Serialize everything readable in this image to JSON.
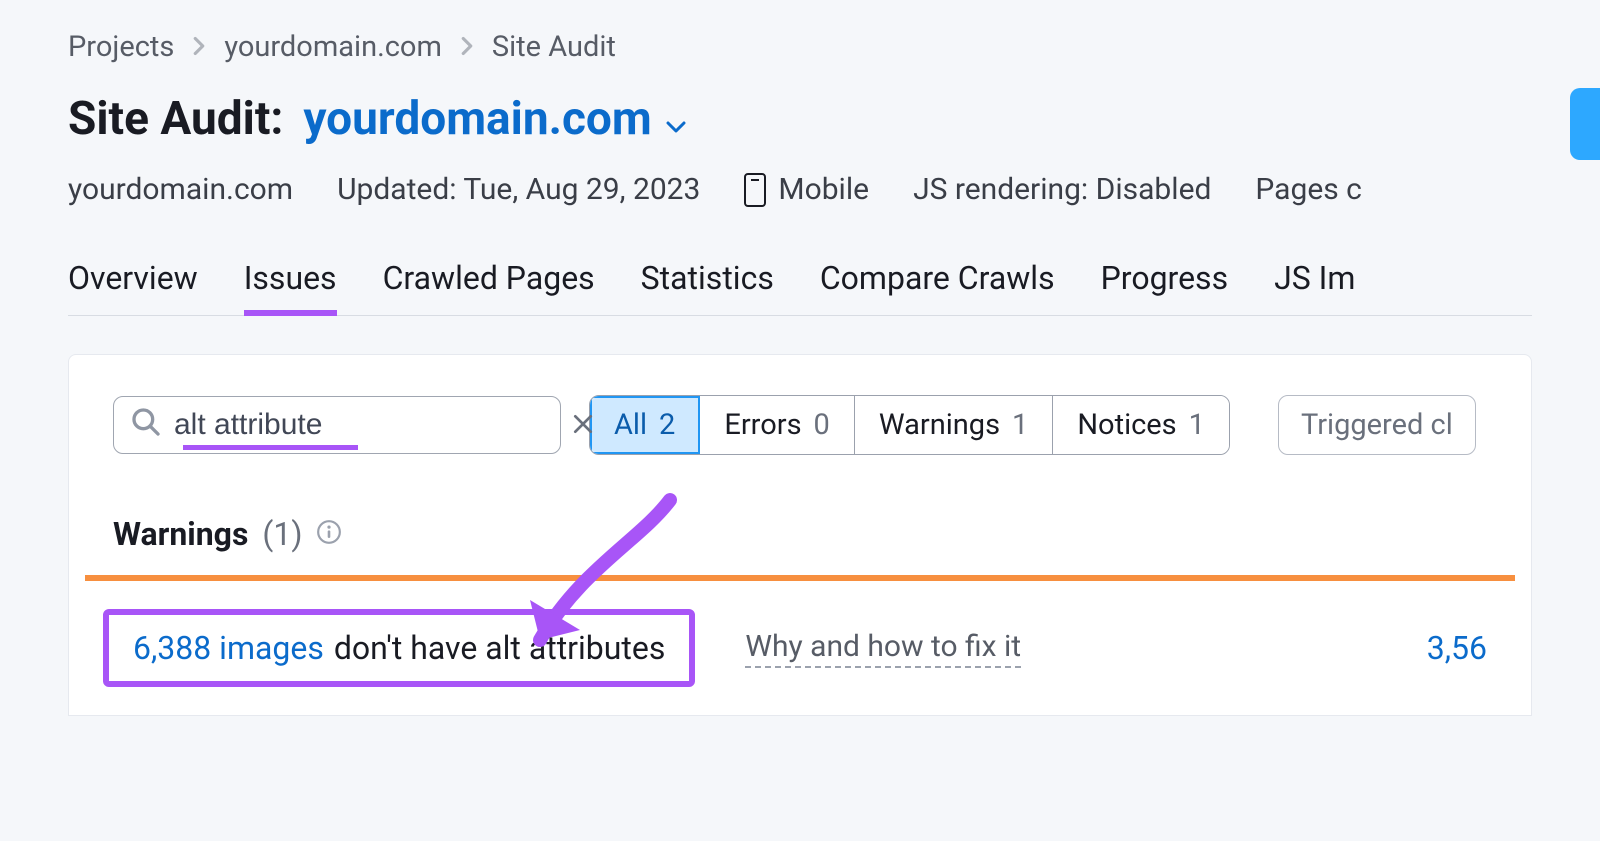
{
  "breadcrumb": {
    "items": [
      "Projects",
      "yourdomain.com",
      "Site Audit"
    ]
  },
  "header": {
    "title_label": "Site Audit:",
    "domain": "yourdomain.com"
  },
  "meta": {
    "domain": "yourdomain.com",
    "updated": "Updated: Tue, Aug 29, 2023",
    "device": "Mobile",
    "js": "JS rendering: Disabled",
    "pages": "Pages c"
  },
  "tabs": [
    "Overview",
    "Issues",
    "Crawled Pages",
    "Statistics",
    "Compare Crawls",
    "Progress",
    "JS Im"
  ],
  "active_tab": 1,
  "search": {
    "value": "alt attribute"
  },
  "filters": [
    {
      "label": "All",
      "count": "2",
      "active": true
    },
    {
      "label": "Errors",
      "count": "0",
      "active": false
    },
    {
      "label": "Warnings",
      "count": "1",
      "active": false
    },
    {
      "label": "Notices",
      "count": "1",
      "active": false
    }
  ],
  "extra_filter": "Triggered cl",
  "section": {
    "label": "Warnings",
    "count": "(1)"
  },
  "issue": {
    "link": "6,388 images",
    "text": "don't have alt attributes",
    "why": "Why and how to fix it",
    "right": "3,56"
  }
}
